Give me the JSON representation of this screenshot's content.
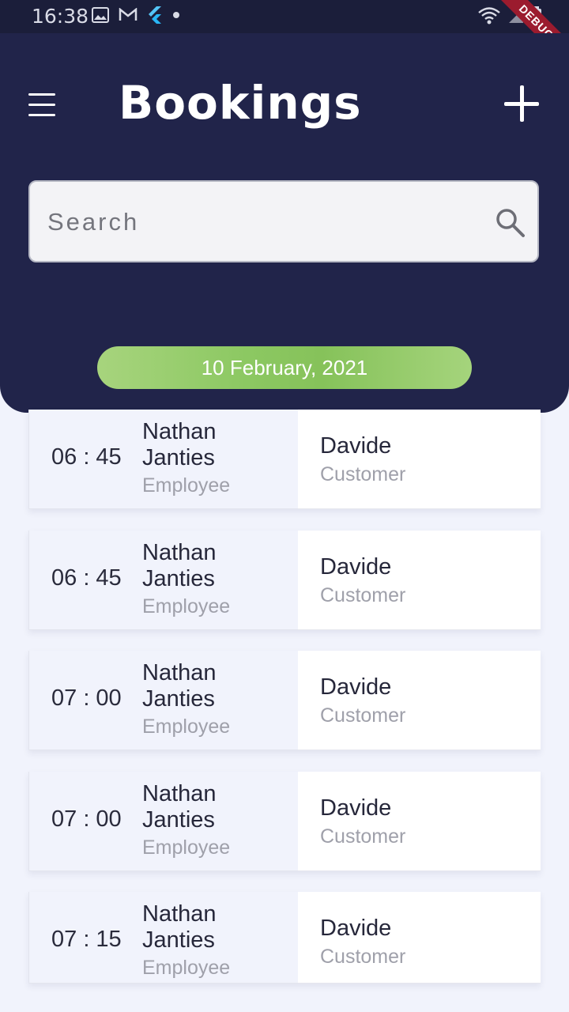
{
  "status_bar": {
    "time": "16:38",
    "debug_label": "DEBUG"
  },
  "header": {
    "title": "Bookings"
  },
  "search": {
    "placeholder": "Search"
  },
  "date_label": "10 February, 2021",
  "bookings": [
    {
      "time": "06 : 45",
      "employee_name": "Nathan Janties",
      "employee_role": "Employee",
      "customer_name": "Davide",
      "customer_role": "Customer"
    },
    {
      "time": "06 : 45",
      "employee_name": "Nathan Janties",
      "employee_role": "Employee",
      "customer_name": "Davide",
      "customer_role": "Customer"
    },
    {
      "time": "07 : 00",
      "employee_name": "Nathan Janties",
      "employee_role": "Employee",
      "customer_name": "Davide",
      "customer_role": "Customer"
    },
    {
      "time": "07 : 00",
      "employee_name": "Nathan Janties",
      "employee_role": "Employee",
      "customer_name": "Davide",
      "customer_role": "Customer"
    },
    {
      "time": "07 : 15",
      "employee_name": "Nathan Janties",
      "employee_role": "Employee",
      "customer_name": "Davide",
      "customer_role": "Customer"
    }
  ],
  "colors": {
    "header_bg": "#21244a",
    "page_bg": "#f1f3fc",
    "accent_green": "#8cc862"
  }
}
